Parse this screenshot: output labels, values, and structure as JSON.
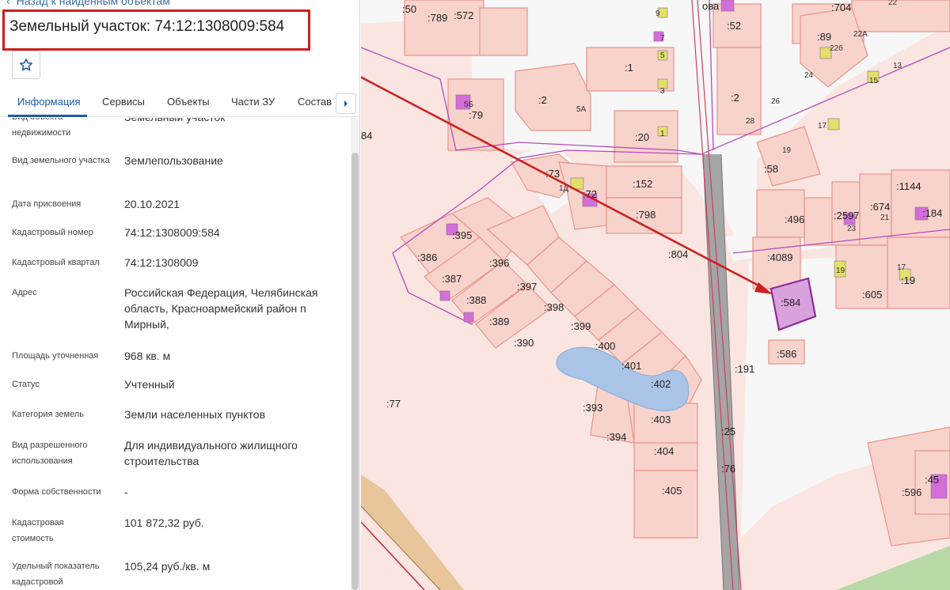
{
  "panel": {
    "back_link": "Назад к найденным объектам",
    "title": "Земельный участок: 74:12:1308009:584",
    "tabs": [
      "Информация",
      "Сервисы",
      "Объекты",
      "Части ЗУ",
      "Состав"
    ],
    "rows": [
      {
        "label": "Вид объекта недвижимости",
        "value": "Земельный участок"
      },
      {
        "label": "Вид земельного участка",
        "value": "Землепользование"
      },
      {
        "label": "Дата присвоения",
        "value": "20.10.2021"
      },
      {
        "label": "Кадастровый номер",
        "value": "74:12:1308009:584"
      },
      {
        "label": "Кадастровый квартал",
        "value": "74:12:1308009"
      },
      {
        "label": "Адрес",
        "value": "Российская Федерация, Челябинская область, Красноармейский район п Мирный,"
      },
      {
        "label": "Площадь уточненная",
        "value": "968 кв. м"
      },
      {
        "label": "Статус",
        "value": "Учтенный"
      },
      {
        "label": "Категория земель",
        "value": "Земли населенных пунктов"
      },
      {
        "label": "Вид разрешенного использования",
        "value": "Для индивидуального жилищного строительства"
      },
      {
        "label": "Форма собственности",
        "value": "-"
      },
      {
        "label": "Кадастровая стоимость",
        "value": "101 872,32 руб."
      },
      {
        "label": "Удельный показатель кадастровой",
        "value": "105,24 руб./кв. м"
      }
    ]
  },
  "map": {
    "street_fragment": "ова",
    "plot_labels": [
      ":50",
      ":789",
      ":572",
      ":704",
      ":52",
      ":89",
      ":1",
      ":2",
      ":79",
      ":2",
      ":20",
      ":58",
      ":73",
      ":72",
      ":152",
      ":798",
      ":1144",
      ":496",
      ":2597",
      ":674",
      ":184",
      ":395",
      ":386",
      ":396",
      ":387",
      ":397",
      ":388",
      ":398",
      ":389",
      ":399",
      ":390",
      ":400",
      ":401",
      ":402",
      ":393",
      ":403",
      ":394",
      ":404",
      ":405",
      ":804",
      ":4089",
      ":584",
      ":605",
      ":19",
      ":586",
      ":191",
      ":77",
      ":25",
      ":76",
      ":596",
      ":45",
      "84"
    ],
    "house_numbers": [
      "9",
      "7",
      "5",
      "3",
      "1",
      "5А",
      "5Б",
      "22",
      "22А",
      "22б",
      "13",
      "15",
      "24",
      "26",
      "28",
      "17",
      "19",
      "1Д",
      "21",
      "23",
      "19",
      "17"
    ],
    "highlight_color": "#8b2b9a",
    "arrow_color": "#cc1f1f",
    "parcel_fill": "#f8d3cc",
    "parcel_stroke": "#e8938a",
    "road_color": "#a5a5a5",
    "water_color": "#a9c4e6"
  }
}
